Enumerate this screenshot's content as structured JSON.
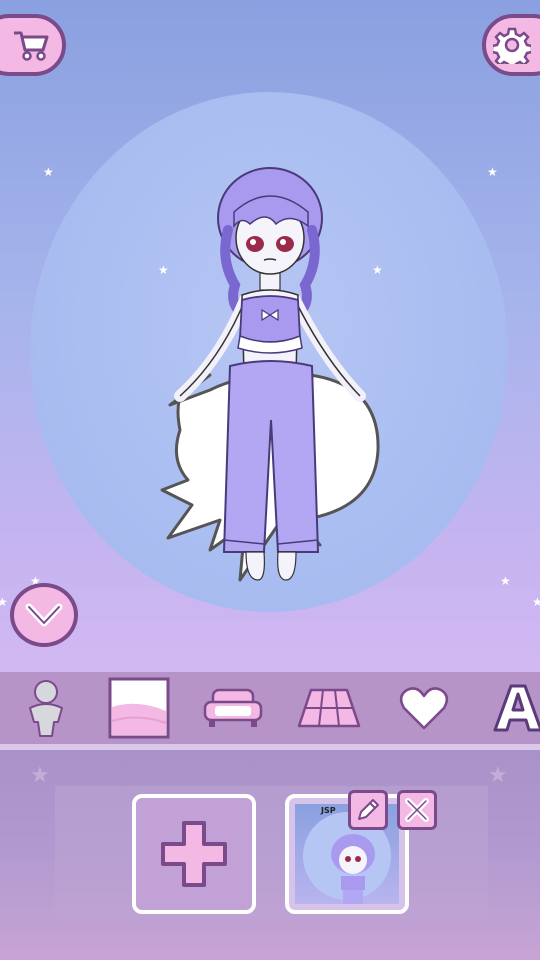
{
  "colors": {
    "accent_pink": "#f4b8e4",
    "outline_purple": "#7a4a8a",
    "toolbar": "#b694c8",
    "panel": "#b29ad0",
    "outfit_lavender": "#a99af0"
  },
  "top_bar": {
    "cart_icon": "cart-icon",
    "settings_icon": "gear-icon"
  },
  "stage": {
    "collapse_icon": "chevron-down-icon"
  },
  "toolbar": {
    "tabs": [
      {
        "name": "character",
        "icon": "person-silhouette-icon"
      },
      {
        "name": "background",
        "icon": "landscape-frame-icon"
      },
      {
        "name": "furniture",
        "icon": "sofa-icon"
      },
      {
        "name": "floor",
        "icon": "floor-tiles-icon"
      },
      {
        "name": "stickers",
        "icon": "heart-icon"
      },
      {
        "name": "text",
        "icon": "letter-a-icon",
        "label": "A"
      }
    ]
  },
  "saves": {
    "add_icon": "plus-icon",
    "slots": [
      {
        "label": "JSP",
        "edit_icon": "pencil-icon",
        "delete_icon": "close-x-icon"
      }
    ]
  }
}
